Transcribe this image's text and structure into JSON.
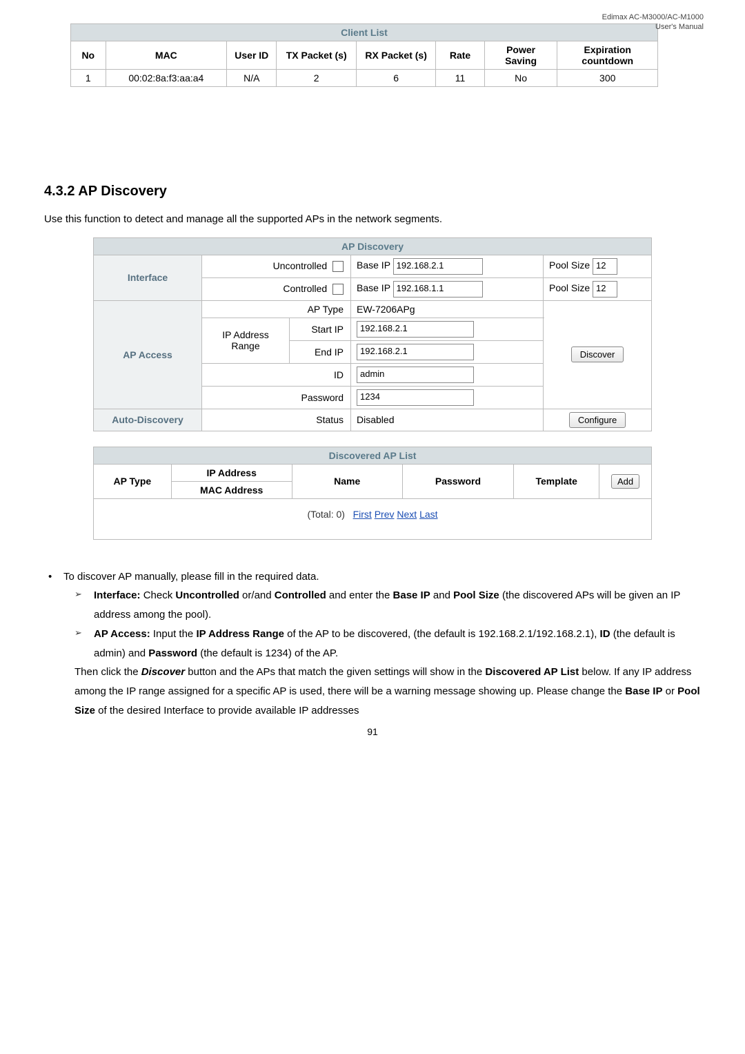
{
  "header": {
    "line1": "Edimax AC-M3000/AC-M1000",
    "line2": "User's Manual"
  },
  "client_list": {
    "title": "Client List",
    "cols": [
      "No",
      "MAC",
      "User ID",
      "TX Packet (s)",
      "RX Packet (s)",
      "Rate",
      "Power Saving",
      "Expiration countdown"
    ],
    "row": {
      "no": "1",
      "mac": "00:02:8a:f3:aa:a4",
      "uid": "N/A",
      "tx": "2",
      "rx": "6",
      "rate": "11",
      "ps": "No",
      "exp": "300"
    }
  },
  "section": {
    "num_title": "4.3.2 AP Discovery",
    "intro": "Use this function to detect and manage all the supported APs in the network segments."
  },
  "ap_discovery": {
    "title": "AP Discovery",
    "interface_label": "Interface",
    "uncontrolled": "Uncontrolled",
    "controlled": "Controlled",
    "base_ip_label": "Base IP",
    "base_ip1": "192.168.2.1",
    "base_ip2": "192.168.1.1",
    "pool_size_label": "Pool Size",
    "pool_size1": "12",
    "pool_size2": "12",
    "ap_access_label": "AP Access",
    "ap_type_label": "AP Type",
    "ap_type_value": "EW-7206APg",
    "ip_range_label": "IP Address Range",
    "start_ip_label": "Start IP",
    "start_ip_value": "192.168.2.1",
    "end_ip_label": "End IP",
    "end_ip_value": "192.168.2.1",
    "id_label": "ID",
    "id_value": "admin",
    "password_label": "Password",
    "password_value": "1234",
    "discover_btn": "Discover",
    "auto_discovery_label": "Auto-Discovery",
    "status_label": "Status",
    "status_value": "Disabled",
    "configure_btn": "Configure"
  },
  "discovered": {
    "title": "Discovered AP List",
    "ap_type": "AP Type",
    "ip_addr": "IP Address",
    "mac_addr": "MAC Address",
    "name": "Name",
    "password": "Password",
    "template": "Template",
    "add_btn": "Add",
    "total_prefix": "(Total: 0)",
    "first": "First",
    "prev": "Prev",
    "next": "Next",
    "last": "Last"
  },
  "notes": {
    "b1": "To discover AP manually, please fill in the required data.",
    "b2a": "Interface:",
    "b2b": " Check ",
    "b2c": "Uncontrolled",
    "b2d": " or/and ",
    "b2e": "Controlled",
    "b2f": " and enter the ",
    "b2g": "Base IP",
    "b2h": " and ",
    "b2i": "Pool Size",
    "b2j": " (the discovered APs will be given an IP address among the pool).",
    "b3a": "AP Access:",
    "b3b": " Input the ",
    "b3c": "IP Address Range",
    "b3d": " of the AP to be discovered, (the default is 192.168.2.1/192.168.2.1), ",
    "b3e": "ID",
    "b3f": " (the default is admin) and ",
    "b3g": "Password",
    "b3h": " (the default is 1234) of the AP.",
    "p1a": "Then click the ",
    "p1b": "Discover",
    "p1c": " button and the APs that match the given settings will show in the ",
    "p1d": "Discovered AP List",
    "p1e": " below. If any IP address among the IP range assigned for a specific AP is used, there will be a warning message showing up. Please change the ",
    "p1f": "Base IP",
    "p1g": " or ",
    "p1h": "Pool Size",
    "p1i": " of the desired Interface to provide available IP addresses"
  },
  "page_number": "91"
}
